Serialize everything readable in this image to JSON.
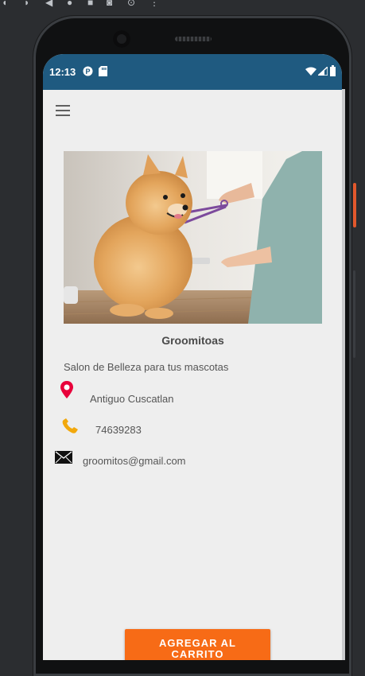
{
  "emulator_toolbar": {
    "icons": [
      "rotate-left-icon",
      "rotate-right-icon",
      "back-icon",
      "home-icon",
      "overview-icon",
      "screenshot-icon",
      "settings-icon",
      "more-icon"
    ]
  },
  "status_bar": {
    "time": "12:13",
    "background": "#1f5a80"
  },
  "app": {
    "menu_icon": "hamburger-menu-icon"
  },
  "salon": {
    "name": "Groomitoas",
    "description": "Salon de Belleza para tus mascotas",
    "location": "Antiguo Cuscatlan",
    "phone": "74639283",
    "email": "groomitos@gmail.com"
  },
  "cart_button": {
    "label": "AGREGAR AL CARRITO",
    "color": "#f76b16"
  }
}
